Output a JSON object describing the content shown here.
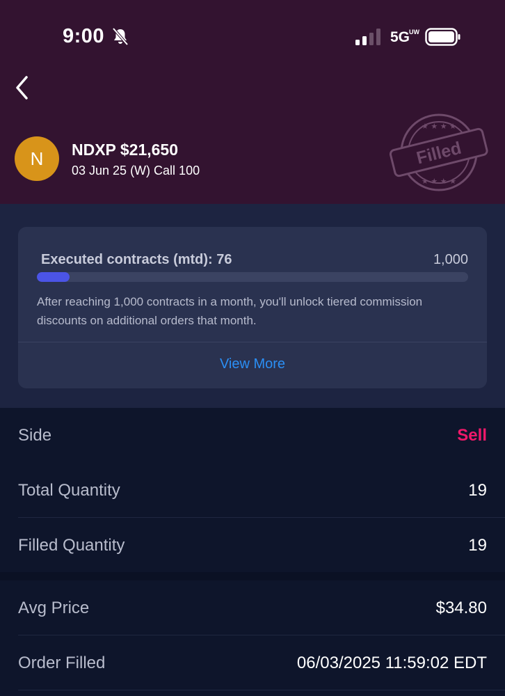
{
  "status_bar": {
    "time": "9:00",
    "network": "5G",
    "network_sub": "UW",
    "icons": [
      "bell-slash-icon",
      "signal-icon",
      "battery-icon"
    ]
  },
  "header": {
    "back_icon": "chevron-left-icon",
    "avatar_letter": "N",
    "title": "NDXP $21,650",
    "subtitle": "03 Jun 25 (W) Call 100",
    "stamp_text": "Filled"
  },
  "progress_card": {
    "label": "Executed contracts (mtd): 76",
    "max_label": "1,000",
    "progress_fraction": 0.076,
    "description": "After reaching 1,000 contracts in a month, you'll unlock tiered commission discounts on additional orders that month.",
    "view_more": "View More"
  },
  "details": [
    {
      "label": "Side",
      "value": "Sell"
    },
    {
      "label": "Total Quantity",
      "value": "19"
    },
    {
      "label": "Filled Quantity",
      "value": "19"
    },
    {
      "label": "Avg Price",
      "value": "$34.80"
    },
    {
      "label": "Order Filled",
      "value": "06/03/2025 11:59:02 EDT"
    }
  ],
  "colors": {
    "header_bg": "#331330",
    "card_section_bg": "#1d2441",
    "card_bg": "#2a3250",
    "page_bg": "#0e152b",
    "progress_fill": "#4b54e6",
    "link": "#2b8ff5",
    "sell": "#f0196a",
    "avatar": "#d8941a"
  }
}
